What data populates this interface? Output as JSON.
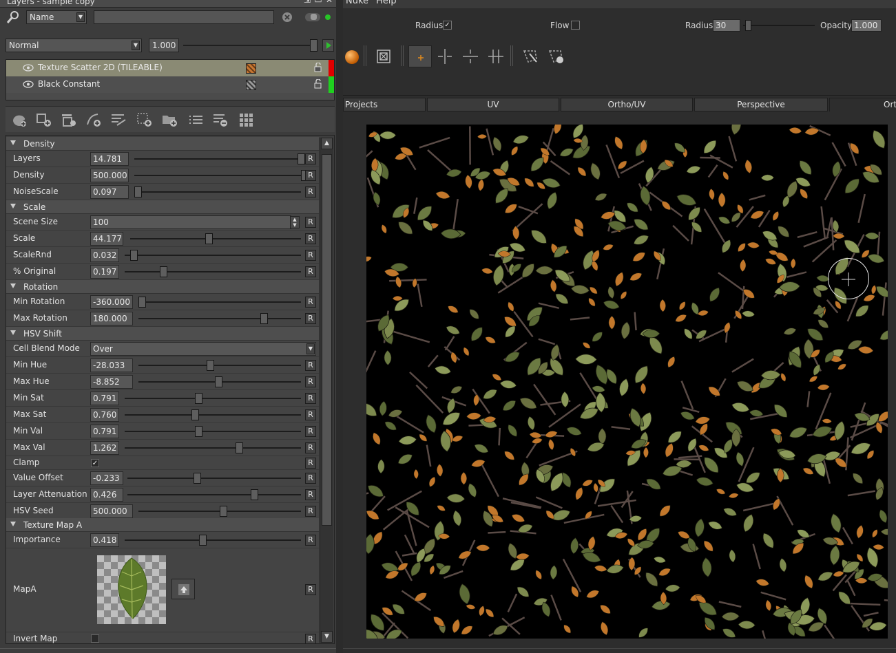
{
  "window": {
    "title": "Layers - sample copy"
  },
  "search": {
    "filter_value": "Name",
    "text_value": ""
  },
  "blend": {
    "mode": "Normal",
    "opacity": "1.000"
  },
  "layers": [
    {
      "name": "Texture Scatter 2D (TILEABLE)",
      "tag_color": "#e00000"
    },
    {
      "name": "Black Constant",
      "tag_color": "#1fd01f"
    }
  ],
  "sections": {
    "density": "Density",
    "scale": "Scale",
    "rotation": "Rotation",
    "hsv": "HSV Shift",
    "texmap": "Texture Map A"
  },
  "params": {
    "layers": {
      "label": "Layers",
      "value": "14.781",
      "level": 0.98
    },
    "density": {
      "label": "Density",
      "value": "500.000",
      "level": 1.0
    },
    "noisescale": {
      "label": "NoiseScale",
      "value": "0.097",
      "level": 0.0
    },
    "scene_size": {
      "label": "Scene Size",
      "value": "100"
    },
    "scale": {
      "label": "Scale",
      "value": "44.177",
      "level": 0.44
    },
    "scalernd": {
      "label": "ScaleRnd",
      "value": "0.032",
      "level": 0.03
    },
    "pct_original": {
      "label": "% Original",
      "value": "0.197",
      "level": 0.2
    },
    "min_rotation": {
      "label": "Min Rotation",
      "value": "-360.000",
      "level": 0.0
    },
    "max_rotation": {
      "label": "Max Rotation",
      "value": "180.000",
      "level": 0.75
    },
    "cell_blend": {
      "label": "Cell Blend Mode",
      "value": "Over"
    },
    "min_hue": {
      "label": "Min Hue",
      "value": "-28.033",
      "level": 0.42
    },
    "max_hue": {
      "label": "Max Hue",
      "value": "-8.852",
      "level": 0.47
    },
    "min_sat": {
      "label": "Min Sat",
      "value": "0.791",
      "level": 0.4
    },
    "max_sat": {
      "label": "Max Sat",
      "value": "0.760",
      "level": 0.38
    },
    "min_val": {
      "label": "Min Val",
      "value": "0.791",
      "level": 0.4
    },
    "max_val": {
      "label": "Max Val",
      "value": "1.262",
      "level": 0.63
    },
    "clamp": {
      "label": "Clamp",
      "checked": true
    },
    "value_offset": {
      "label": "Value Offset",
      "value": "-0.233",
      "level": 0.38
    },
    "layer_att": {
      "label": "Layer Attenuation",
      "value": "0.426",
      "level": 0.71
    },
    "hsv_seed": {
      "label": "HSV Seed",
      "value": "500.000",
      "level": 0.5
    },
    "importance": {
      "label": "Importance",
      "value": "0.418",
      "level": 0.42
    },
    "mapa": {
      "label": "MapA"
    },
    "invert_map": {
      "label": "Invert Map",
      "checked": false
    }
  },
  "reset_label": "R",
  "menu": {
    "items": [
      "Nuke",
      "Help"
    ]
  },
  "brush_options": {
    "radius_chk_label": "Radius",
    "radius_checked": true,
    "flow_label": "Flow",
    "flow_checked": false,
    "radius_label": "Radius",
    "radius_value": "30",
    "radius_level": 0.03,
    "opacity_label": "Opacity",
    "opacity_value": "1.000"
  },
  "tabs": [
    "Projects",
    "UV",
    "Ortho/UV",
    "Perspective",
    "Ort"
  ],
  "icons": {
    "toolbar": [
      "paint-layer-add-icon",
      "layer-add-icon",
      "layer-stack-icon",
      "adjustment-add-icon",
      "merge-layers-icon",
      "procedural-add-icon",
      "folder-add-icon",
      "list-icon",
      "layer-remove-icon",
      "grid-icon"
    ],
    "viewer": [
      "sphere-icon",
      "frame-icon",
      "crosshair-icon",
      "split-horizontal-icon",
      "split-vertical-icon",
      "split-grid-icon",
      "lasso-icon",
      "lasso-add-icon"
    ]
  },
  "colors": {
    "panel": "#3c3c3c",
    "selected_layer": "#8a8a74",
    "viewport_bg": "#000000",
    "leaf_green": "#6b7a42",
    "leaf_orange": "#c2772b",
    "twig": "#5a4b46"
  }
}
